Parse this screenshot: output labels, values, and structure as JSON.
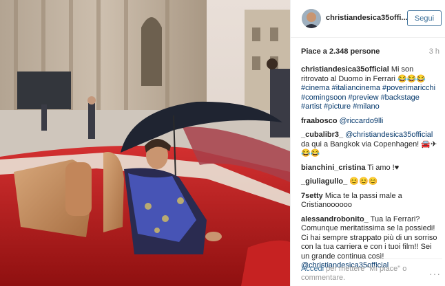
{
  "post": {
    "username": "christiandesica35offi...",
    "follow_label": "Segui",
    "likes": "Piace a 2.348 persone",
    "time": "3 h"
  },
  "comments": [
    {
      "user": "christiandesica35official",
      "text": " Mi son ritrovato al Duomo in Ferrari 😂😂😂 ",
      "tags": "#cinema #italiancinema #poverimaricchi #comingsoon #preview #backstage #artist #picture #milano"
    },
    {
      "user": "fraabosco",
      "text": " ",
      "tags": "@riccardo9lli"
    },
    {
      "user": "_cubalibr3_",
      "text": " ",
      "tags": "@christiandesica35official",
      "after": " da qui a Bangkok via Copenhagen! 🚘✈😂😂"
    },
    {
      "user": "bianchini_cristina",
      "text": " Ti amo !♥"
    },
    {
      "user": "_giuliagullo_",
      "text": " 😊😊😊"
    },
    {
      "user": "7setty",
      "text": " Mica te la passi male a Cristianoooooo"
    },
    {
      "user": "alessandrobonito_",
      "text": " Tua la Ferrari? Comunque meritatissima se la possiedi! Ci hai sempre strappato più di un sorriso con la tua carriera e con i tuoi film!! Sei un grande continua così! ",
      "tags": "@christiandesica35official"
    }
  ],
  "footer": {
    "login_link": "Accedi",
    "login_text": " per mettere \"Mi piace\" o commentare.",
    "more": "···"
  }
}
